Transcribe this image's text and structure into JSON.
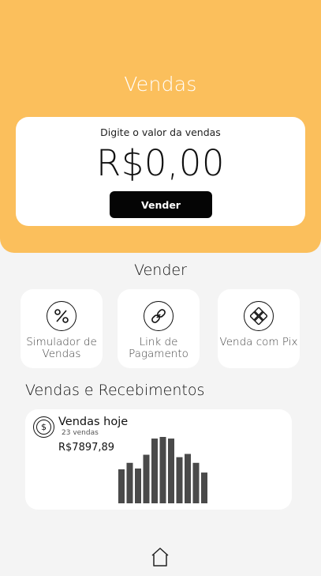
{
  "header": {
    "title": "Vendas"
  },
  "value_card": {
    "label": "Digite o valor da vendas",
    "amount": "R$0,00",
    "button_label": "Vender"
  },
  "sell_section": {
    "title": "Vender",
    "actions": [
      {
        "label": "Simulador de Vendas",
        "icon": "percent-icon"
      },
      {
        "label": "Link de Pagamento",
        "icon": "link-icon"
      },
      {
        "label": "Venda com Pix",
        "icon": "pix-icon"
      }
    ]
  },
  "sales_section": {
    "title": "Vendas e Recebimentos",
    "today": {
      "title": "Vendas hoje",
      "count": "23 vendas",
      "amount": "R$7897,89",
      "icon": "dollar-icon"
    }
  },
  "chart_data": {
    "type": "bar",
    "values": [
      42,
      50,
      43,
      60,
      80,
      82,
      80,
      57,
      61,
      50,
      38
    ],
    "color": "#4a4a4a"
  },
  "nav": {
    "home_icon": "home-icon"
  },
  "colors": {
    "accent": "#fbbf5c",
    "button": "#050505",
    "background": "#f4f4f4"
  }
}
